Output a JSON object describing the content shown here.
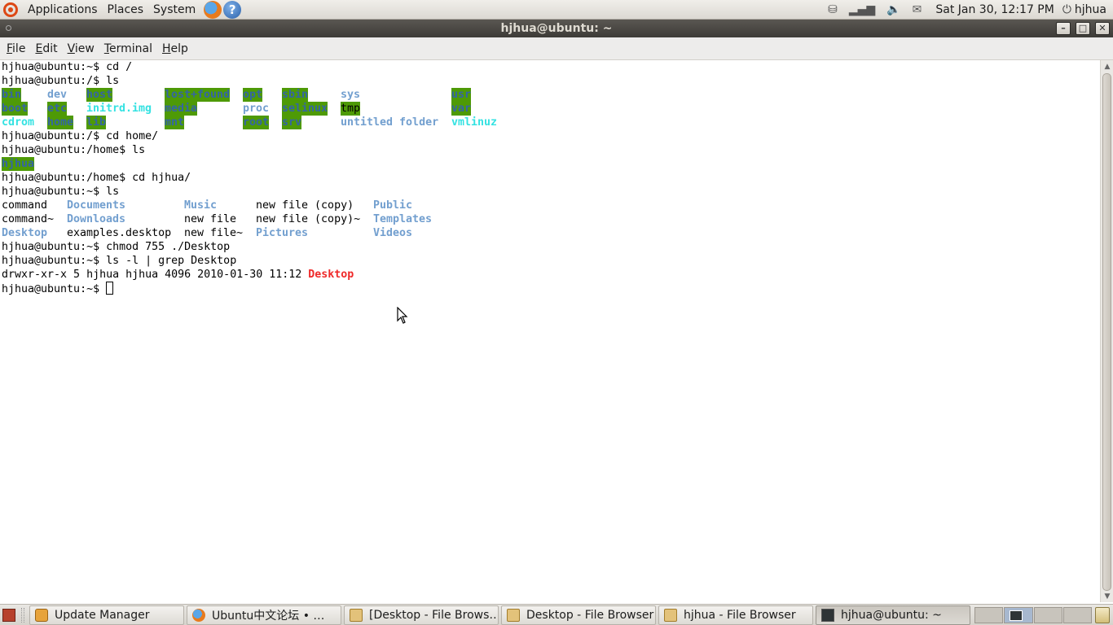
{
  "top_panel": {
    "menus": [
      "Applications",
      "Places",
      "System"
    ],
    "clock": "Sat Jan 30, 12:17 PM",
    "user": "hjhua"
  },
  "window": {
    "title": "hjhua@ubuntu: ~"
  },
  "menubar": {
    "file": {
      "acc": "F",
      "rest": "ile"
    },
    "edit": {
      "acc": "E",
      "rest": "dit"
    },
    "view": {
      "acc": "V",
      "rest": "iew"
    },
    "terminal": {
      "acc": "T",
      "rest": "erminal"
    },
    "help": {
      "acc": "H",
      "rest": "elp"
    }
  },
  "terminal": {
    "l1": "hjhua@ubuntu:~$ cd /",
    "l2": "hjhua@ubuntu:/$ ls",
    "root_ls": {
      "bin": "bin",
      "dev": "dev",
      "host": "host",
      "lost_found": "lost+found",
      "opt": "opt",
      "sbin": "sbin",
      "sys": "sys",
      "usr": "usr",
      "boot": "boot",
      "etc": "etc",
      "initrd": "initrd.img",
      "media": "media",
      "proc": "proc",
      "selinux": "selinux",
      "tmp": "tmp",
      "var": "var",
      "cdrom": "cdrom",
      "home": "home",
      "lib": "lib",
      "mnt": "mnt",
      "root": "root",
      "srv": "srv",
      "untitled": "untitled folder",
      "vmlinuz": "vmlinuz"
    },
    "l6": "hjhua@ubuntu:/$ cd home/",
    "l7": "hjhua@ubuntu:/home$ ls",
    "home_ls": "hjhua",
    "l9": "hjhua@ubuntu:/home$ cd hjhua/",
    "l10": "hjhua@ubuntu:~$ ls",
    "user_ls": {
      "command": "command",
      "documents": "Documents",
      "music": "Music",
      "new_copy": "new file (copy)",
      "public": "Public",
      "command_bak": "command~",
      "downloads": "Downloads",
      "new_file": "new file",
      "new_copy_bak": "new file (copy)~",
      "templates": "Templates",
      "desktop": "Desktop",
      "examples": "examples.desktop",
      "new_file_bak": "new file~",
      "pictures": "Pictures",
      "videos": "Videos"
    },
    "l14": "hjhua@ubuntu:~$ chmod 755 ./Desktop",
    "l15": "hjhua@ubuntu:~$ ls -l | grep Desktop",
    "l16_prefix": "drwxr-xr-x 5 hjhua hjhua 4096 2010-01-30 11:12 ",
    "l16_name": "Desktop",
    "l17": "hjhua@ubuntu:~$ "
  },
  "taskbar": {
    "tasks": [
      {
        "label": "Update Manager",
        "icon": "update-manager-icon"
      },
      {
        "label": "Ubuntu中文论坛 • …",
        "icon": "firefox-icon"
      },
      {
        "label": "[Desktop - File Brows…",
        "icon": "folder-icon"
      },
      {
        "label": "Desktop - File Browser",
        "icon": "folder-icon"
      },
      {
        "label": "hjhua - File Browser",
        "icon": "folder-icon"
      },
      {
        "label": "hjhua@ubuntu: ~",
        "icon": "terminal-icon"
      }
    ]
  },
  "colors": {
    "directory": "#729fcf",
    "symlink": "#34e2e2",
    "sticky_bg": "#4e9a06",
    "executable": "#ef2929"
  }
}
